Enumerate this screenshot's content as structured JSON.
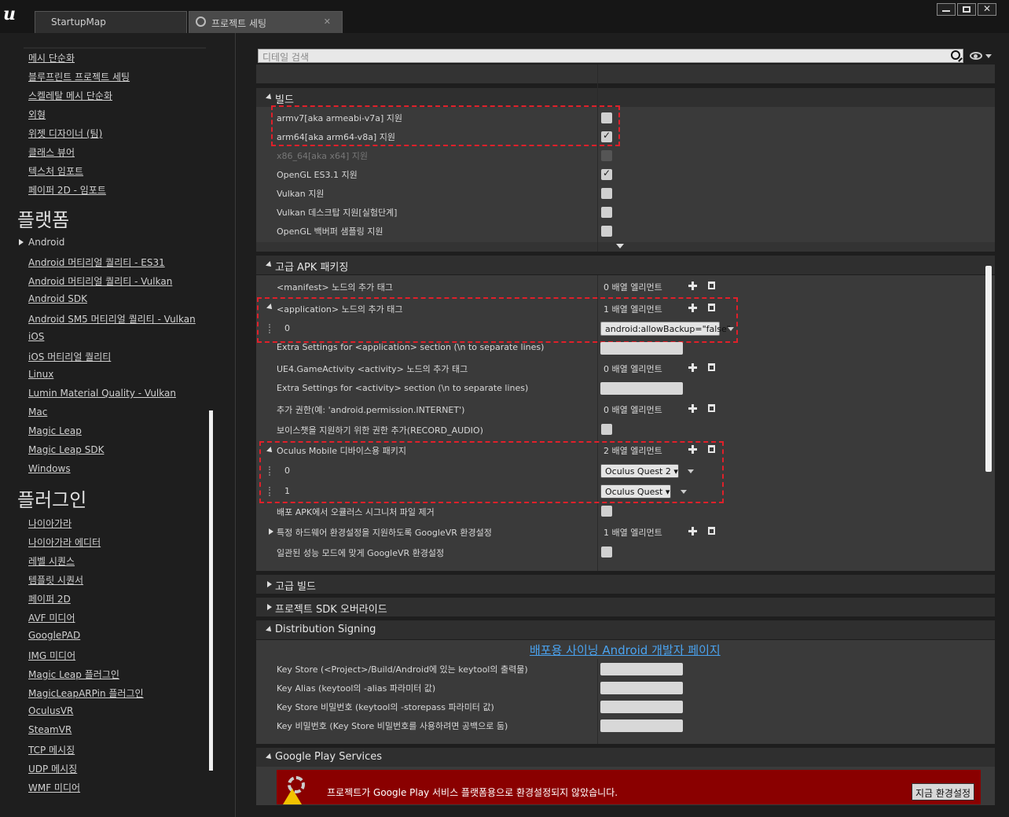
{
  "tabs": [
    {
      "label": "StartupMap"
    },
    {
      "label": "프로젝트 세팅"
    }
  ],
  "window_controls": {
    "minimize": "—",
    "maximize": "□",
    "close": "✕"
  },
  "sidebar": {
    "items_top": [
      "메시 단순화",
      "블루프린트 프로젝트 세팅",
      "스켈레탈 메시 단순화",
      "외형",
      "위젯 디자이너 (팀)",
      "클래스 뷰어",
      "텍스처 임포트",
      "페이퍼 2D - 임포트"
    ],
    "platforms_heading": "플랫폼",
    "platforms": [
      "Android",
      "Android 머티리얼 퀄리티 - ES31",
      "Android 머티리얼 퀄리티 - Vulkan",
      "Android SDK",
      "Android SM5 머티리얼 퀄리티 - Vulkan",
      "iOS",
      "iOS 머티리얼 퀄리티",
      "Linux",
      "Lumin Material Quality - Vulkan",
      "Mac",
      "Magic Leap",
      "Magic Leap SDK",
      "Windows"
    ],
    "plugins_heading": "플러그인",
    "plugins": [
      "나이아가라",
      "나이아가라 에디터",
      "레벨 시퀀스",
      "템플릿 시퀀서",
      "페이퍼 2D",
      "AVF 미디어",
      "GooglePAD",
      "IMG 미디어",
      "Magic Leap 플러그인",
      "MagicLeapARPin 플러그인",
      "OculusVR",
      "SteamVR",
      "TCP 메시징",
      "UDP 메시징",
      "WMF 미디어"
    ]
  },
  "search": {
    "placeholder": "디테일 검색"
  },
  "build": {
    "title": "빌드",
    "rows": [
      {
        "label": "armv7[aka armeabi-v7a] 지원"
      },
      {
        "label": "arm64[aka arm64-v8a] 지원"
      },
      {
        "label": "x86_64[aka x64] 지원"
      },
      {
        "label": "OpenGL ES3.1 지원"
      },
      {
        "label": "Vulkan 지원"
      },
      {
        "label": "Vulkan 데스크탑 지원[실험단계]"
      },
      {
        "label": "OpenGL 백버퍼 샘플링 지원"
      }
    ],
    "checked": [
      false,
      true,
      false,
      true,
      false,
      false,
      false
    ]
  },
  "apk": {
    "title": "고급 APK 패키징",
    "manifest_label": "<manifest> 노드의 추가 태그",
    "manifest_value": "0 배열 엘리먼트",
    "application_label": "<application> 노드의 추가 태그",
    "application_value": "1 배열 엘리먼트",
    "application_index": "0",
    "application_item": "android:allowBackup=\"false\"",
    "extra_app_label": "Extra Settings for <application> section (\\n to separate lines)",
    "activity_label": "UE4.GameActivity <activity> 노드의 추가 태그",
    "activity_value": "0 배열 엘리먼트",
    "extra_activity_label": "Extra Settings for <activity> section (\\n to separate lines)",
    "permission_label": "추가 권한(예: 'android.permission.INTERNET')",
    "permission_value": "0 배열 엘리먼트",
    "voice_label": "보이스챗을 지원하기 위한 권한 추가(RECORD_AUDIO)",
    "oculus_label": "Oculus Mobile 디바이스용 패키지",
    "oculus_value": "2 배열 엘리먼트",
    "oculus_items": [
      {
        "index": "0",
        "value": "Oculus Quest 2"
      },
      {
        "index": "1",
        "value": "Oculus Quest"
      }
    ],
    "remove_sig_label": "배포 APK에서 오큘러스 시그니처 파일 제거",
    "googlevr_label": "특정 하드웨어 환경설정을 지원하도록 GoogleVR 환경설정",
    "googlevr_value": "1 배열 엘리먼트",
    "sustained_label": "일관된 성능 모드에 맞게 GoogleVR 환경설정"
  },
  "advanced_build": {
    "title": "고급 빌드"
  },
  "sdk_override": {
    "title": "프로젝트 SDK 오버라이드"
  },
  "signing": {
    "title": "Distribution Signing",
    "link": "배포용 사이닝 Android 개발자 페이지",
    "rows": [
      "Key Store (<Project>/Build/Android에 있는 keytool의 출력물)",
      "Key Alias (keytool의 -alias 파라미터 값)",
      "Key Store 비밀번호 (keytool의 -storepass 파라미터 값)",
      "Key 비밀번호 (Key Store 비밀번호를 사용하려면 공백으로 둠)"
    ]
  },
  "gps": {
    "title": "Google Play Services",
    "warning": "프로젝트가 Google Play 서비스 플랫폼용으로 환경설정되지 않았습니다.",
    "button": "지금 환경설정"
  }
}
